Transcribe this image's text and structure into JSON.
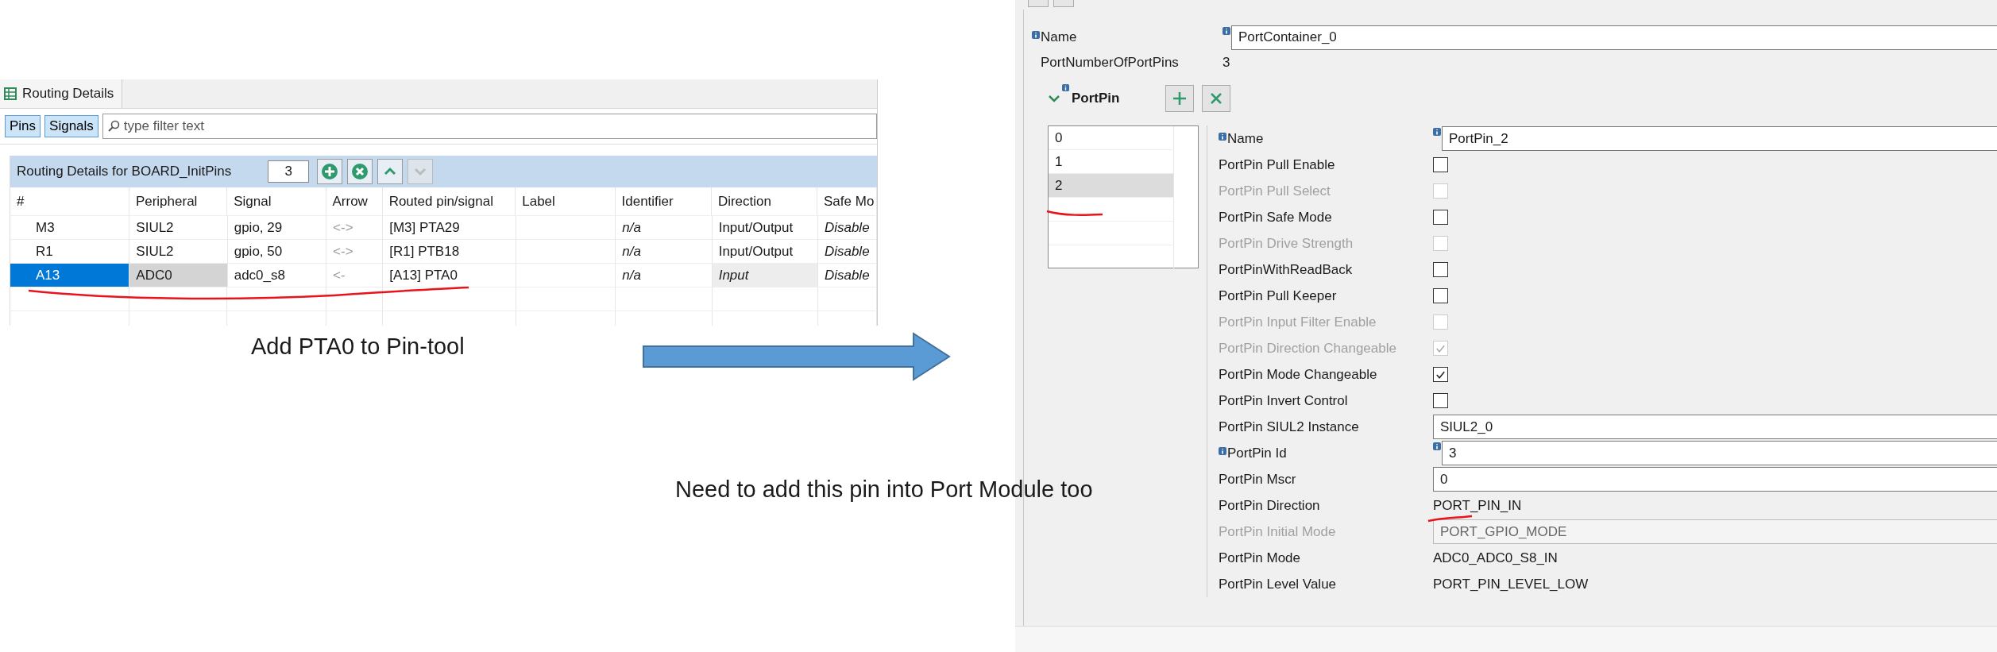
{
  "left_panel": {
    "tab": {
      "label": "Routing Details"
    },
    "view_buttons": [
      {
        "label": "Pins",
        "selected": true
      },
      {
        "label": "Signals",
        "selected": true
      }
    ],
    "filter": {
      "placeholder": "type filter text"
    },
    "group": {
      "title": "Routing Details for BOARD_InitPins",
      "count": "3",
      "buttons": [
        {
          "kind": "add",
          "disabled": false
        },
        {
          "kind": "remove",
          "disabled": false
        },
        {
          "kind": "up",
          "disabled": false
        },
        {
          "kind": "down",
          "disabled": true
        }
      ]
    },
    "table": {
      "columns": [
        "#",
        "Peripheral",
        "Signal",
        "Arrow",
        "Routed pin/signal",
        "Label",
        "Identifier",
        "Direction",
        "Safe Mo"
      ],
      "rows": [
        {
          "cells": [
            "M3",
            "SIUL2",
            "gpio, 29",
            "<->",
            "[M3] PTA29",
            "",
            "n/a",
            "Input/Output",
            "Disable"
          ],
          "selected": false
        },
        {
          "cells": [
            "R1",
            "SIUL2",
            "gpio, 50",
            "<->",
            "[R1] PTB18",
            "",
            "n/a",
            "Input/Output",
            "Disable"
          ],
          "selected": false
        },
        {
          "cells": [
            "A13",
            "ADC0",
            "adc0_s8",
            "<-",
            "[A13] PTA0",
            "",
            "n/a",
            "Input",
            "Disable"
          ],
          "selected": true
        }
      ]
    }
  },
  "annotations": [
    "Add PTA0 to Pin-tool",
    "Need to add this pin into Port Module too"
  ],
  "right_panel": {
    "name": {
      "label": "Name",
      "value": "PortContainer_0",
      "info": true
    },
    "pin_count": {
      "label": "PortNumberOfPortPins",
      "value": "3"
    },
    "section": {
      "title": "PortPin",
      "expanded": true,
      "info": true
    },
    "pin_list": [
      {
        "label": "0",
        "selected": false
      },
      {
        "label": "1",
        "selected": false
      },
      {
        "label": "2",
        "selected": true
      }
    ],
    "properties": [
      {
        "kind": "field",
        "label": "Name",
        "value": "PortPin_2",
        "info": true,
        "disabled": false
      },
      {
        "kind": "checkbox",
        "label": "PortPin Pull Enable",
        "checked": false,
        "disabled": false
      },
      {
        "kind": "checkbox",
        "label": "PortPin Pull Select",
        "checked": false,
        "disabled": true
      },
      {
        "kind": "checkbox",
        "label": "PortPin Safe Mode",
        "checked": false,
        "disabled": false
      },
      {
        "kind": "checkbox",
        "label": "PortPin Drive Strength",
        "checked": false,
        "disabled": true
      },
      {
        "kind": "checkbox",
        "label": "PortPinWithReadBack",
        "checked": false,
        "disabled": false
      },
      {
        "kind": "checkbox",
        "label": "PortPin Pull Keeper",
        "checked": false,
        "disabled": false
      },
      {
        "kind": "checkbox",
        "label": "PortPin Input Filter Enable",
        "checked": false,
        "disabled": true
      },
      {
        "kind": "checkbox",
        "label": "PortPin Direction Changeable",
        "checked": true,
        "disabled": true
      },
      {
        "kind": "checkbox",
        "label": "PortPin Mode Changeable",
        "checked": true,
        "disabled": false
      },
      {
        "kind": "checkbox",
        "label": "PortPin Invert Control",
        "checked": false,
        "disabled": false
      },
      {
        "kind": "field",
        "label": "PortPin SIUL2 Instance",
        "value": "SIUL2_0",
        "info": false,
        "disabled": false
      },
      {
        "kind": "field",
        "label": "PortPin Id",
        "value": "3",
        "info": true,
        "disabled": false
      },
      {
        "kind": "field",
        "label": "PortPin Mscr",
        "value": "0",
        "info": false,
        "disabled": false
      },
      {
        "kind": "text",
        "label": "PortPin Direction",
        "value": "PORT_PIN_IN",
        "disabled": false
      },
      {
        "kind": "field",
        "label": "PortPin Initial Mode",
        "value": "PORT_GPIO_MODE",
        "info": false,
        "disabled": true
      },
      {
        "kind": "text",
        "label": "PortPin Mode",
        "value": "ADC0_ADC0_S8_IN",
        "disabled": false
      },
      {
        "kind": "text",
        "label": "PortPin Level Value",
        "value": "PORT_PIN_LEVEL_LOW",
        "disabled": false
      }
    ]
  }
}
